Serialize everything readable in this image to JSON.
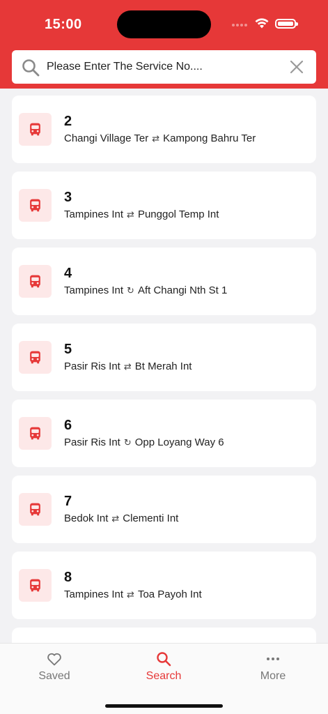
{
  "status_bar": {
    "time": "15:00"
  },
  "search": {
    "placeholder": "Please Enter The Service No....",
    "value": ""
  },
  "colors": {
    "accent": "#e63838",
    "tile_bg": "#fde8e8"
  },
  "services": [
    {
      "number": "2",
      "from": "Changi Village Ter",
      "direction": "⇄",
      "to": "Kampong Bahru Ter"
    },
    {
      "number": "3",
      "from": "Tampines Int",
      "direction": "⇄",
      "to": "Punggol Temp Int"
    },
    {
      "number": "4",
      "from": "Tampines Int",
      "direction": "↻",
      "to": "Aft Changi Nth St 1"
    },
    {
      "number": "5",
      "from": "Pasir Ris Int",
      "direction": "⇄",
      "to": "Bt Merah Int"
    },
    {
      "number": "6",
      "from": "Pasir Ris Int",
      "direction": "↻",
      "to": "Opp Loyang Way 6"
    },
    {
      "number": "7",
      "from": "Bedok Int",
      "direction": "⇄",
      "to": "Clementi Int"
    },
    {
      "number": "8",
      "from": "Tampines Int",
      "direction": "⇄",
      "to": "Toa Payoh Int"
    }
  ],
  "tabs": [
    {
      "label": "Saved",
      "icon": "heart-icon",
      "active": false
    },
    {
      "label": "Search",
      "icon": "search-icon",
      "active": true
    },
    {
      "label": "More",
      "icon": "more-icon",
      "active": false
    }
  ]
}
